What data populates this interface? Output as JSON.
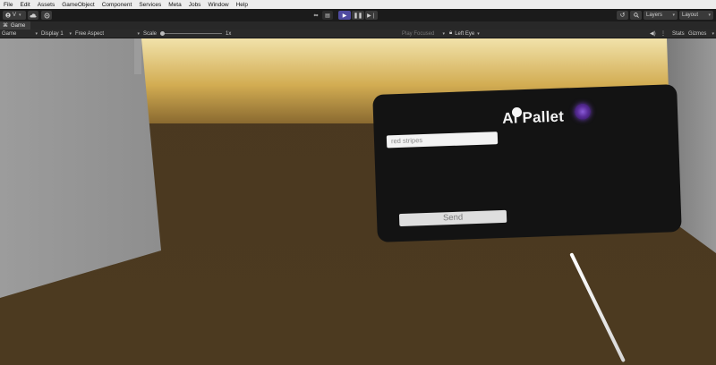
{
  "menu": [
    "File",
    "Edit",
    "Assets",
    "GameObject",
    "Component",
    "Services",
    "Meta",
    "Jobs",
    "Window",
    "Help"
  ],
  "toolbar": {
    "account_label": "V",
    "layers_label": "Layers",
    "layout_label": "Layout",
    "icons": [
      "account-icon",
      "cloud-icon",
      "gear-icon",
      "meta-icon",
      "scene-icon",
      "play-icon",
      "pause-icon",
      "step-icon",
      "history-icon",
      "search-icon"
    ],
    "play_active_color": "#4f4aa0"
  },
  "tab": {
    "label": "Game",
    "icon": "game-controller-icon"
  },
  "gamebar": {
    "mode": "Game",
    "display": "Display 1",
    "aspect": "Free Aspect",
    "scale_label": "Scale",
    "scale_value": "1x",
    "play_focused": "Play Focused",
    "eye": "Left Eye",
    "stats": "Stats",
    "gizmos": "Gizmos"
  },
  "panel": {
    "title": "Ai Pallet",
    "input_value": "red stripes",
    "send_label": "Send",
    "logo_icon": "purple-orb-logo-icon"
  },
  "colors": {
    "floor": "#4a391f",
    "ceiling": "#d8b860",
    "wall": "#9a9a9a",
    "panel_bg": "#131313"
  }
}
